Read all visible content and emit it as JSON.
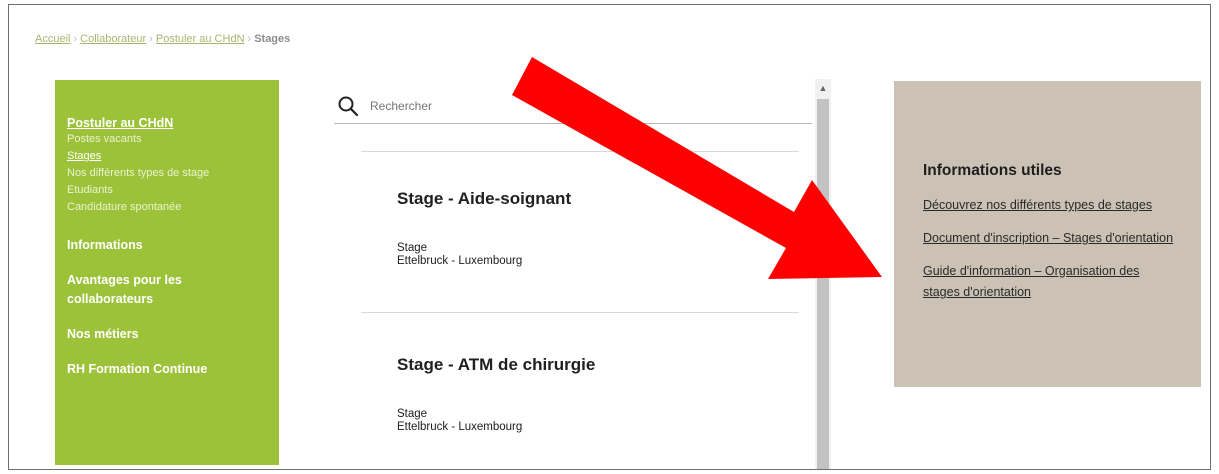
{
  "breadcrumb": {
    "items": [
      "Accueil",
      "Collaborateur",
      "Postuler au CHdN"
    ],
    "current": "Stages",
    "separator": "›"
  },
  "sidebar": {
    "section_title": "Postuler au CHdN",
    "subitems": [
      "Postes vacants",
      "Stages",
      "Nos différents types de stage",
      "Etudiants",
      "Candidature spontanée"
    ],
    "main_items": [
      "Informations",
      "Avantages pour les collaborateurs",
      "Nos métiers",
      "RH Formation Continue"
    ],
    "background_color": "#9cc23a"
  },
  "search": {
    "placeholder": "Rechercher",
    "icon": "search-icon"
  },
  "jobs": [
    {
      "title": "Stage - Aide-soignant",
      "type": "Stage",
      "location": "Ettelbruck - Luxembourg"
    },
    {
      "title": "Stage - ATM de chirurgie",
      "type": "Stage",
      "location": "Ettelbruck - Luxembourg"
    }
  ],
  "info_panel": {
    "title": "Informations utiles",
    "links": [
      "Découvrez nos différents types de stages",
      "Document d'inscription – Stages d'orientation",
      "Guide d'information – Organisation des stages d'orientation"
    ],
    "background_color": "#cbc2b5"
  },
  "annotation": {
    "arrow_color": "#ff0000"
  }
}
